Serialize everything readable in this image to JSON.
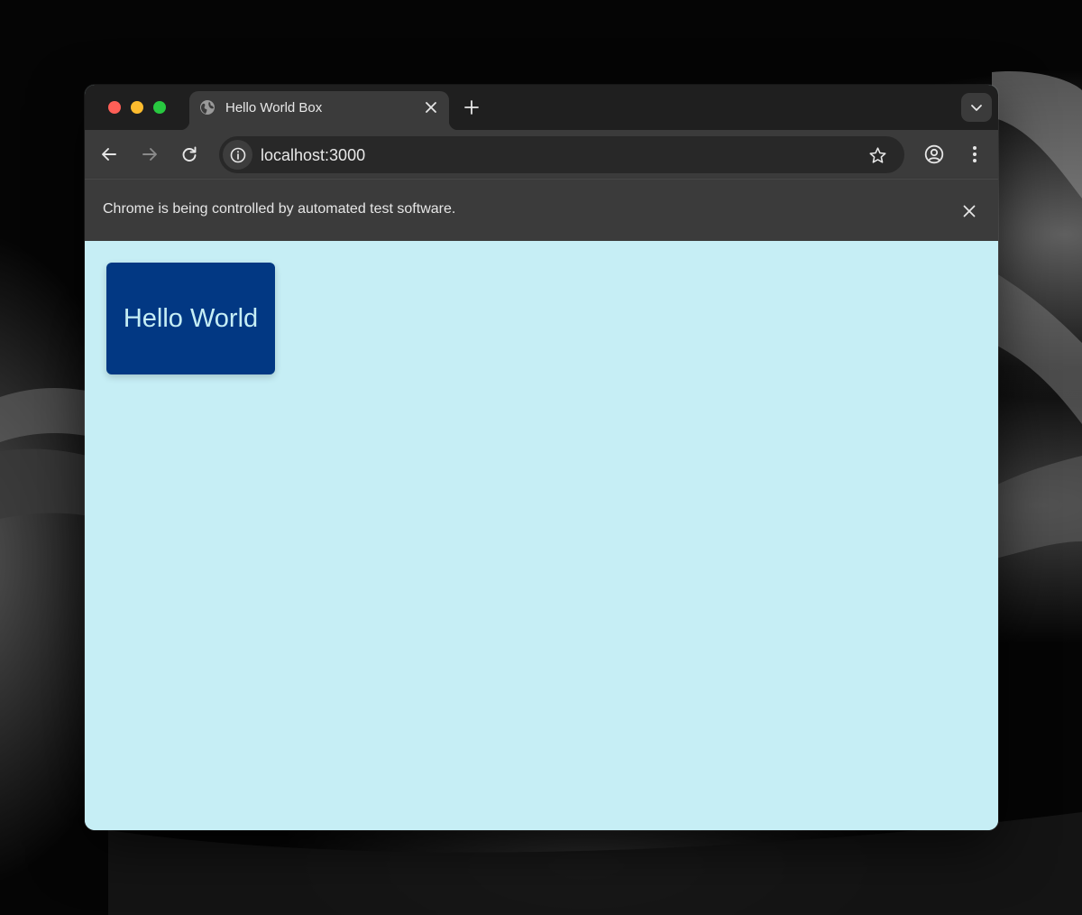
{
  "browser": {
    "tab": {
      "title": "Hello World Box"
    },
    "address_bar": {
      "url": "localhost:3000"
    },
    "infobar": {
      "message": "Chrome is being controlled by automated test software."
    }
  },
  "page": {
    "box_text": "Hello World",
    "colors": {
      "background": "#c6eef5",
      "box": "#023883",
      "box_text": "#c6eef5"
    }
  },
  "icons": {
    "tab_favicon": "globe-icon",
    "tab_close": "close-icon",
    "new_tab": "plus-icon",
    "tab_search": "chevron-down-icon",
    "back": "arrow-left-icon",
    "forward": "arrow-right-icon",
    "reload": "reload-icon",
    "site_info": "info-icon",
    "bookmark": "star-icon",
    "profile": "profile-icon",
    "menu": "more-vertical-icon",
    "infobar_close": "close-icon"
  }
}
